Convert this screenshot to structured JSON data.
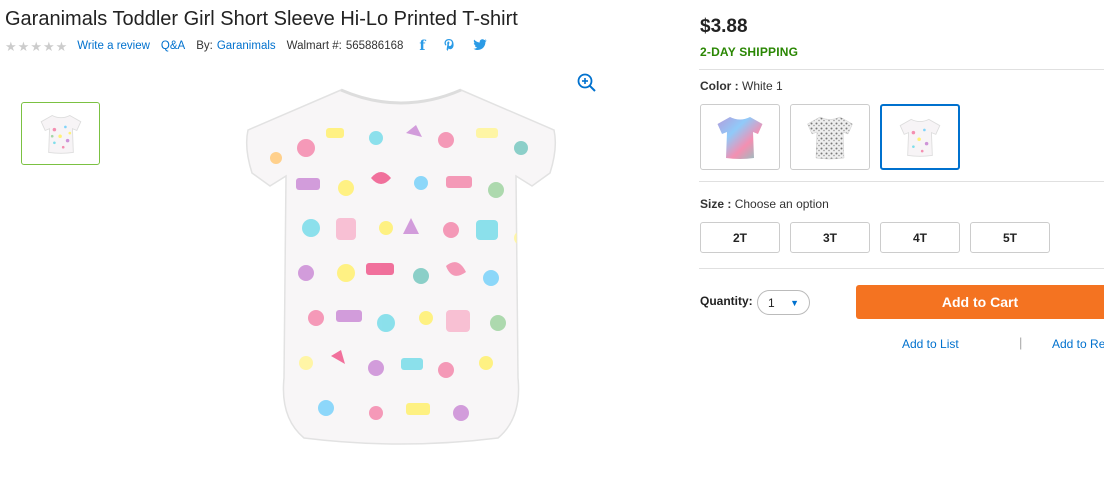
{
  "product": {
    "title": "Garanimals Toddler Girl Short Sleeve Hi-Lo Printed T-shirt",
    "write_review": "Write a review",
    "qa": "Q&A",
    "by_label": "By:",
    "brand": "Garanimals",
    "walmart_label": "Walmart #:",
    "walmart_number": "565886168"
  },
  "social": {
    "facebook": "f",
    "pinterest": "p"
  },
  "pricing": {
    "price": "$3.88",
    "shipping": "2-DAY SHIPPING"
  },
  "color": {
    "label": "Color :",
    "value": "White 1"
  },
  "size": {
    "label": "Size :",
    "value": "Choose an option",
    "options": [
      "2T",
      "3T",
      "4T",
      "5T"
    ]
  },
  "quantity": {
    "label": "Quantity:",
    "value": "1"
  },
  "actions": {
    "add_to_cart": "Add to Cart",
    "add_to_list": "Add to List",
    "add_to_registry": "Add to Re",
    "separator": "|"
  },
  "colors": {
    "accent": "#0071ce",
    "cart": "#f47321",
    "shipping": "#2a8703",
    "thumb_border": "#7bc142"
  }
}
